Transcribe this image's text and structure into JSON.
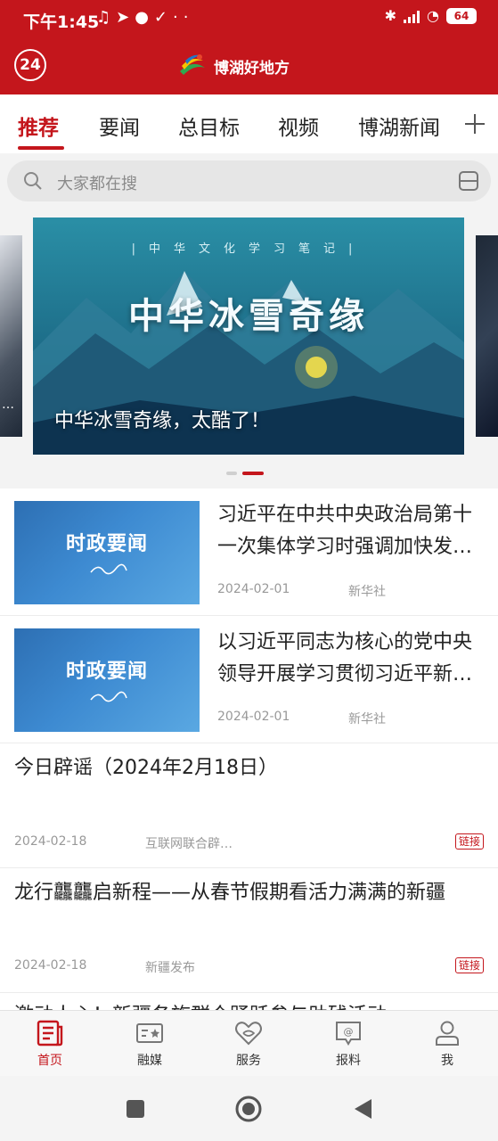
{
  "status_bar": {
    "time": "下午1:45",
    "battery": "64"
  },
  "header": {
    "badge": "24",
    "app_title": "博湖好地方"
  },
  "tabs": [
    {
      "label": "推荐",
      "active": true
    },
    {
      "label": "要闻",
      "active": false
    },
    {
      "label": "总目标",
      "active": false
    },
    {
      "label": "视频",
      "active": false
    },
    {
      "label": "博湖新闻",
      "active": false
    }
  ],
  "search": {
    "placeholder": "大家都在搜"
  },
  "banner": {
    "subtitle": "|中华文化学习笔记|",
    "title": "中华冰雪奇缘",
    "caption": "中华冰雪奇缘，太酷了！",
    "slide_count": 2,
    "active_slide": 2
  },
  "news": [
    {
      "thumb_text": "时政要闻",
      "title": "习近平在中共中央政治局第十一次集体学习时强调加快发展新质生产力扎实推进高质量发展",
      "date": "2024-02-01",
      "source": "新华社"
    },
    {
      "thumb_text": "时政要闻",
      "title": "以习近平同志为核心的党中央领导开展学习贯彻习近平新时代中国特色社会主义思想主题教育纪实",
      "date": "2024-02-01",
      "source": "新华社"
    },
    {
      "title": "今日辟谣（2024年2月18日）",
      "date": "2024-02-18",
      "source": "互联网联合辟…",
      "tag": "链接"
    },
    {
      "title": "龙行龘龘启新程——从春节假期看活力满满的新疆",
      "date": "2024-02-18",
      "source": "新疆发布",
      "tag": "链接"
    },
    {
      "title": "激动人心！新疆各族群众踊跃参与助残活动"
    }
  ],
  "bottom_nav": [
    {
      "label": "首页",
      "icon": "news-paper-icon",
      "active": true
    },
    {
      "label": "融媒",
      "icon": "media-card-icon",
      "active": false
    },
    {
      "label": "服务",
      "icon": "heart-service-icon",
      "active": false
    },
    {
      "label": "报料",
      "icon": "report-chat-icon",
      "active": false
    },
    {
      "label": "我",
      "icon": "user-icon",
      "active": false
    }
  ],
  "colors": {
    "brand_red": "#c4161c",
    "page_bg": "#f3f3f3"
  }
}
